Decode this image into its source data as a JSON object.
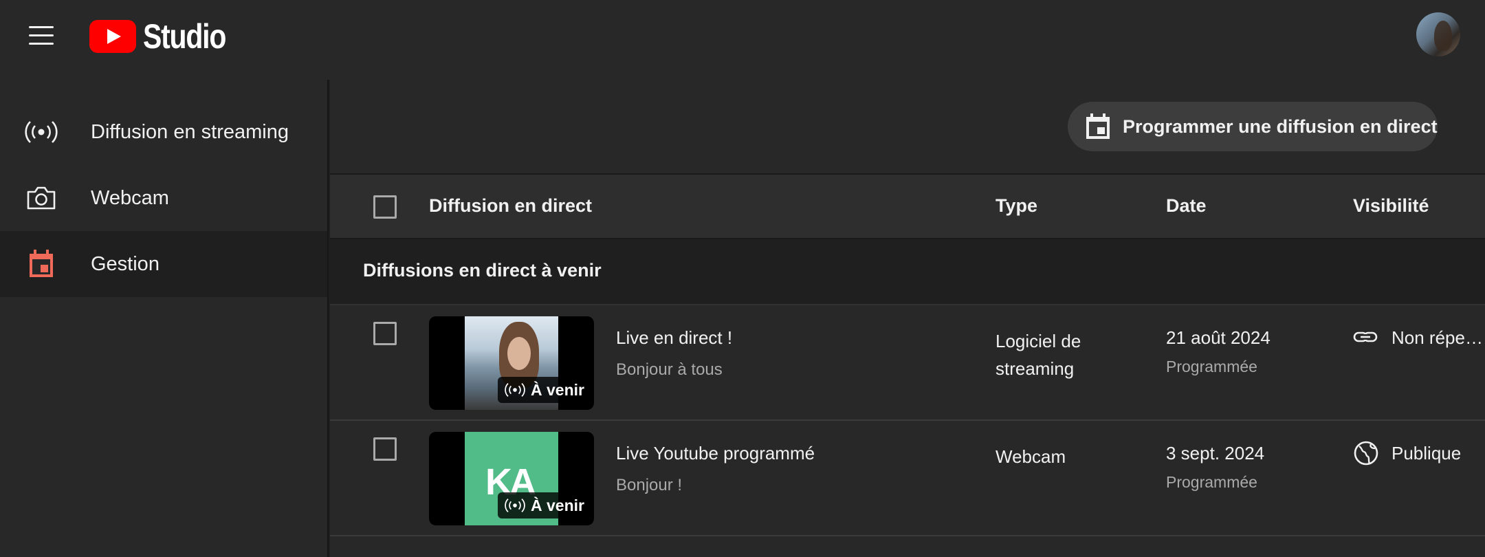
{
  "header": {
    "logo_text": "Studio",
    "menu_icon": "hamburger-menu-icon",
    "avatar_icon": "user-avatar"
  },
  "sidebar": {
    "items": [
      {
        "label": "Diffusion en streaming",
        "icon": "broadcast-icon",
        "active": false
      },
      {
        "label": "Webcam",
        "icon": "camera-icon",
        "active": false
      },
      {
        "label": "Gestion",
        "icon": "calendar-icon",
        "active": true
      }
    ]
  },
  "main": {
    "schedule_button_label": "Programmer une diffusion en direct",
    "table": {
      "columns": {
        "title": "Diffusion en direct",
        "type": "Type",
        "date": "Date",
        "visibility": "Visibilité"
      },
      "section_title": "Diffusions en direct à venir",
      "rows": [
        {
          "title": "Live en direct !",
          "description": "Bonjour à tous",
          "badge": "À venir",
          "type": "Logiciel de streaming",
          "date": "21 août 2024",
          "status": "Programmée",
          "visibility": "Non répertoriée",
          "visibility_icon": "link-icon"
        },
        {
          "title": "Live Youtube programmé",
          "description": "Bonjour !",
          "badge": "À venir",
          "thumb_text": "KA",
          "type": "Webcam",
          "date": "3 sept. 2024",
          "status": "Programmée",
          "visibility": "Publique",
          "visibility_icon": "globe-icon"
        }
      ]
    }
  },
  "colors": {
    "background": "#282828",
    "accent": "#ff0000",
    "active_icon": "#f06a5a",
    "thumbnail_green": "#52bc89",
    "muted_text": "#aaaaaa"
  }
}
